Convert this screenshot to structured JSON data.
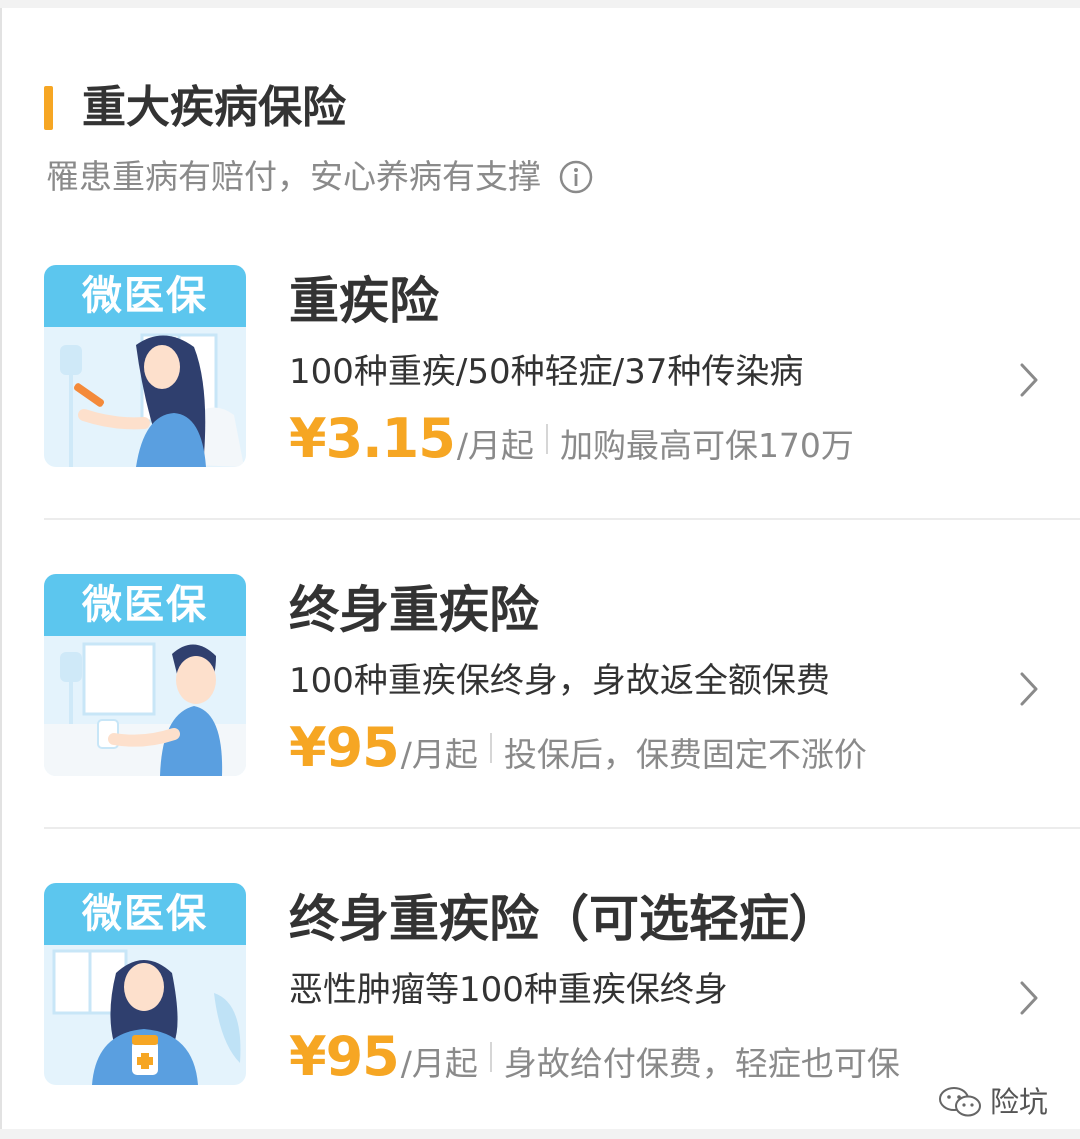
{
  "section": {
    "title": "重大疾病保险",
    "subtitle": "罹患重病有赔付，安心养病有支撑"
  },
  "products": [
    {
      "brand": "微医保",
      "title": "重疾险",
      "description": "100种重疾/50种轻症/37种传染病",
      "price": "¥3.15",
      "unit": "/月起",
      "note": "加购最高可保170万"
    },
    {
      "brand": "微医保",
      "title": "终身重疾险",
      "description": "100种重疾保终身，身故返全额保费",
      "price": "¥95",
      "unit": "/月起",
      "note": "投保后，保费固定不涨价"
    },
    {
      "brand": "微医保",
      "title": "终身重疾险（可选轻症）",
      "description": "恶性肿瘤等100种重疾保终身",
      "price": "¥95",
      "unit": "/月起",
      "note": "身故给付保费，轻症也可保"
    }
  ],
  "watermark": {
    "text": "险坑"
  },
  "icons": {
    "info": "info-circle-icon",
    "chevron": "chevron-right-icon",
    "watermark": "wechat-icon"
  },
  "colors": {
    "accent": "#f6a623",
    "brand_banner": "#5cc6ee",
    "title_text": "#333333",
    "secondary_text": "#8a8a8a"
  }
}
